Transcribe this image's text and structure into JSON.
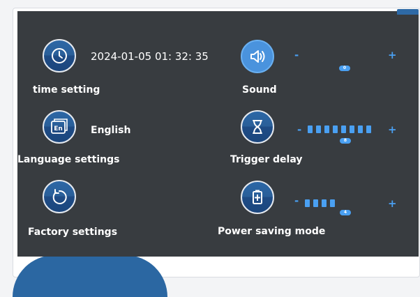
{
  "colors": {
    "panel": "#383c40",
    "accent": "#4aa0f2",
    "circle": "#2c67a6"
  },
  "time": {
    "label": "time setting",
    "value": "2024-01-05 01: 32: 35",
    "icon": "clock-icon"
  },
  "language": {
    "label": "Language settings",
    "value": "English",
    "icon": "language-icon",
    "icon_text": "En"
  },
  "factory": {
    "label": "Factory settings",
    "icon": "reset-icon"
  },
  "sound": {
    "label": "Sound",
    "level": 0,
    "minus": "-",
    "plus": "+",
    "icon": "speaker-icon"
  },
  "trigger": {
    "label": "Trigger delay",
    "level": 8,
    "minus": "-",
    "plus": "+",
    "icon": "hourglass-icon"
  },
  "power": {
    "label": "Power saving mode",
    "level": 4,
    "minus": "-",
    "plus": "+",
    "icon": "battery-icon"
  }
}
